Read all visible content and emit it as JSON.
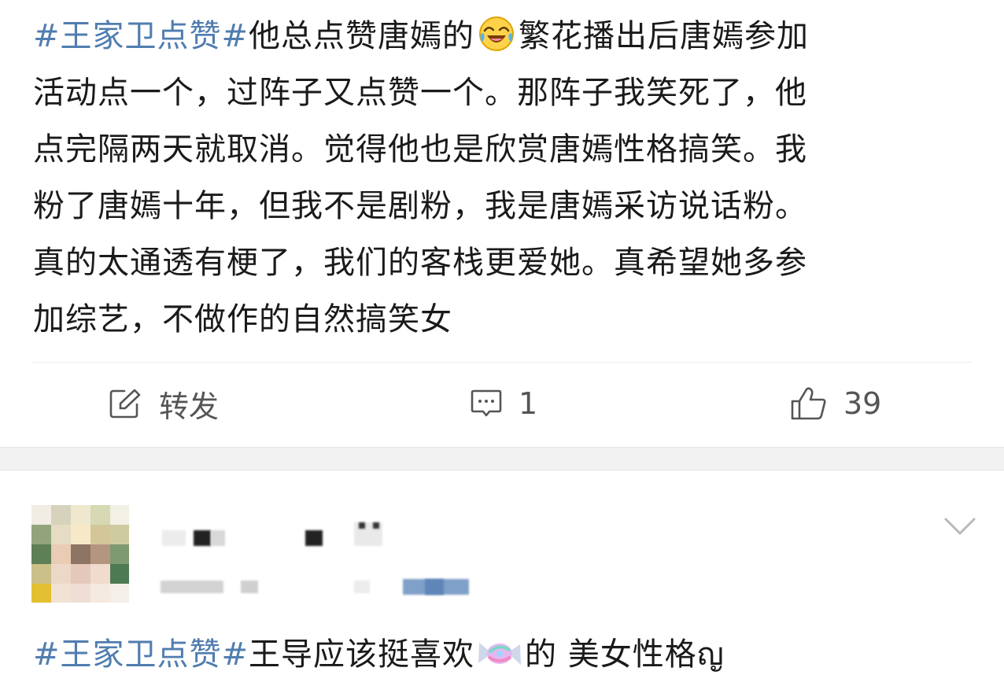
{
  "post1": {
    "hashtag": "#王家卫点赞#",
    "lines": [
      "他总点赞唐嫣的",
      "繁花播出后唐嫣参加",
      "活动点一个，过阵子又点赞一个。那阵子我笑死了，他",
      "点完隔两天就取消。觉得他也是欣赏唐嫣性格搞笑。我",
      "粉了唐嫣十年，但我不是剧粉，我是唐嫣采访说话粉。",
      "真的太通透有梗了，我们的客栈更爱她。真希望她多参",
      "加综艺，不做作的自然搞笑女"
    ],
    "emoji": "laughing-tears-emoji",
    "actions": {
      "repost_label": "转发",
      "comment_count": "1",
      "like_count": "39"
    }
  },
  "post2": {
    "hashtag": "#王家卫点赞#",
    "text_before_emoji": "王导应该挺喜欢",
    "emoji": "candy-emoji",
    "text_after_emoji": "的 美女性格",
    "trailing_char": "ญ"
  },
  "colors": {
    "hashtag": "#507daf",
    "text": "#1a1a1a",
    "action_gray": "#555555",
    "separator": "#f2f2f2"
  }
}
